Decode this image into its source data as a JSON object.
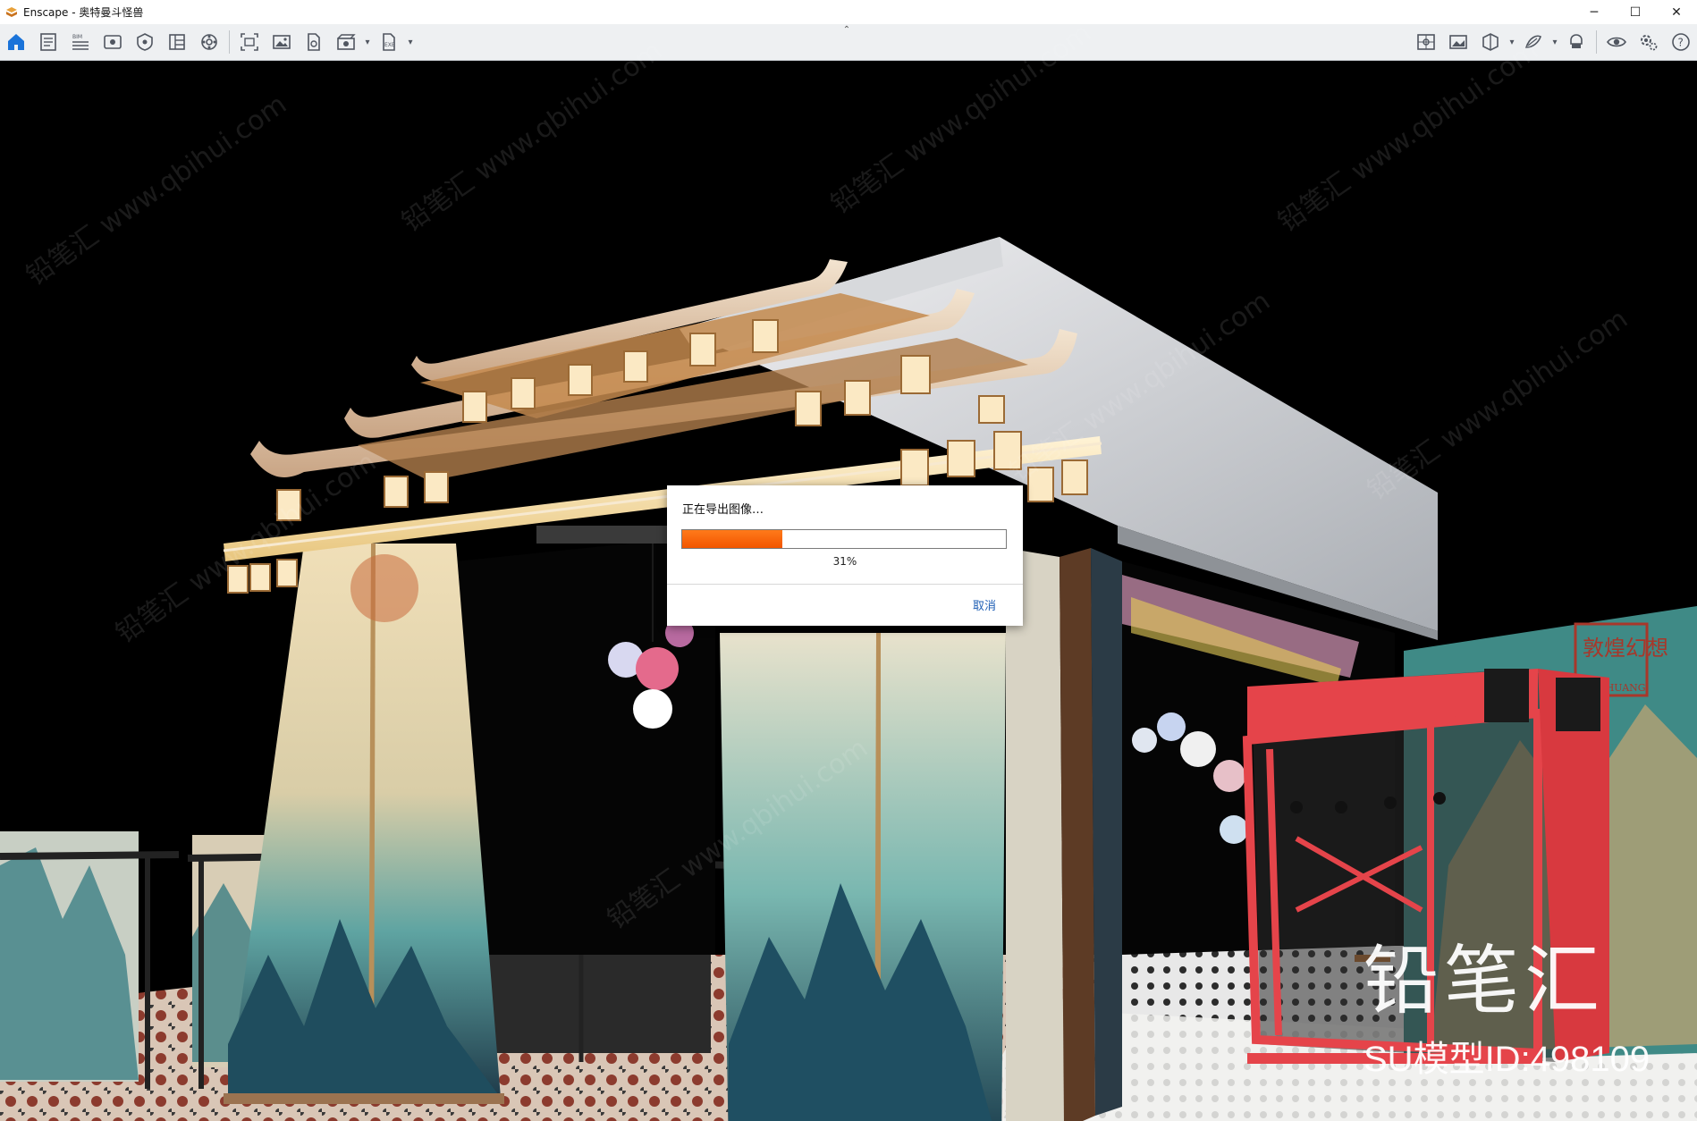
{
  "window": {
    "title": "Enscape - 奥特曼斗怪兽",
    "controls": {
      "minimize": "─",
      "maximize": "☐",
      "close": "✕"
    }
  },
  "toolbar": {
    "left_icons": [
      "home-icon",
      "project-info-icon",
      "bim-icon",
      "view-icon",
      "visual-settings-icon",
      "asset-library-icon",
      "settings-gallery-icon",
      "screenshot-icon",
      "batch-render-icon",
      "export-icon",
      "video-icon",
      "exe-export-icon"
    ],
    "right_icons": [
      "capture-icon",
      "gallery-icon",
      "cube-view-icon",
      "material-icon",
      "vr-icon",
      "visibility-icon",
      "settings-icon",
      "help-icon"
    ],
    "bim_label": "BIM",
    "exe_label": "EXE",
    "help_label": "?",
    "collapse_glyph": "⌃"
  },
  "dialog": {
    "title": "正在导出图像…",
    "progress_percent": 31,
    "percent_label": "31%",
    "cancel_label": "取消"
  },
  "watermark": {
    "main": "铅笔汇",
    "id_text": "SU模型ID:498109",
    "repeat": "铅笔汇  www.qbihui.com"
  },
  "scene": {
    "signboard_text": "敦煌幻想",
    "signboard_sub": "DUNHUANG"
  },
  "colors": {
    "accent_orange": "#f25500",
    "link_blue": "#1f5fb5",
    "home_blue": "#1a73d9",
    "booth_red": "#e5444a"
  }
}
